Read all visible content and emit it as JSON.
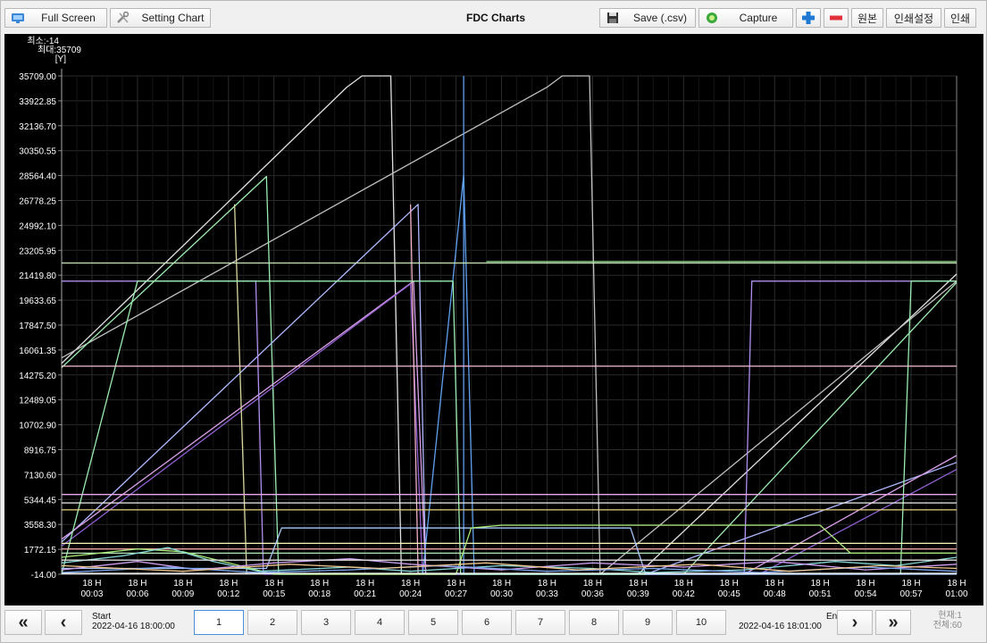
{
  "toolbar": {
    "full_screen": "Full Screen",
    "setting_chart": "Setting Chart",
    "title": "FDC Charts",
    "save": "Save (.csv)",
    "capture": "Capture",
    "original": "원본",
    "print_settings": "인쇄설정",
    "print": "인쇄",
    "icons": [
      "monitor-icon",
      "tools-icon",
      "floppy-disk-icon",
      "capture-icon",
      "zoom-in-icon",
      "zoom-out-icon"
    ]
  },
  "info": {
    "min_label": "최소:-14",
    "max_label": "최대:35709",
    "unit_label": "[Y]"
  },
  "nav": {
    "start_label": "Start",
    "start_value": "2022-04-16 18:00:00",
    "end_label": "End",
    "end_value": "2022-04-16 18:01:00",
    "pages": [
      "1",
      "2",
      "3",
      "4",
      "5",
      "6",
      "7",
      "8",
      "9",
      "10"
    ],
    "active_page": 0,
    "current_label": "현재:1",
    "total_label": "전체:60"
  },
  "chart_data": {
    "type": "line",
    "title": "",
    "xlabel": "",
    "ylabel": "[Y]",
    "ylim": [
      -14,
      35709
    ],
    "xlim": [
      1,
      60
    ],
    "grid": true,
    "y_ticks": [
      "35709.00",
      "33922.85",
      "32136.70",
      "30350.55",
      "28564.40",
      "26778.25",
      "24992.10",
      "23205.95",
      "21419.80",
      "19633.65",
      "17847.50",
      "16061.35",
      "14275.20",
      "12489.05",
      "10702.90",
      "8916.75",
      "7130.60",
      "5344.45",
      "3558.30",
      "1772.15",
      "-14.00"
    ],
    "x_ticks": [
      {
        "x": 3,
        "hour": "18 H",
        "time": "00:03"
      },
      {
        "x": 6,
        "hour": "18 H",
        "time": "00:06"
      },
      {
        "x": 9,
        "hour": "18 H",
        "time": "00:09"
      },
      {
        "x": 12,
        "hour": "18 H",
        "time": "00:12"
      },
      {
        "x": 15,
        "hour": "18 H",
        "time": "00:15"
      },
      {
        "x": 18,
        "hour": "18 H",
        "time": "00:18"
      },
      {
        "x": 21,
        "hour": "18 H",
        "time": "00:21"
      },
      {
        "x": 24,
        "hour": "18 H",
        "time": "00:24"
      },
      {
        "x": 27,
        "hour": "18 H",
        "time": "00:27"
      },
      {
        "x": 30,
        "hour": "18 H",
        "time": "00:30"
      },
      {
        "x": 33,
        "hour": "18 H",
        "time": "00:33"
      },
      {
        "x": 36,
        "hour": "18 H",
        "time": "00:36"
      },
      {
        "x": 39,
        "hour": "18 H",
        "time": "00:39"
      },
      {
        "x": 42,
        "hour": "18 H",
        "time": "00:42"
      },
      {
        "x": 45,
        "hour": "18 H",
        "time": "00:45"
      },
      {
        "x": 48,
        "hour": "18 H",
        "time": "00:48"
      },
      {
        "x": 51,
        "hour": "18 H",
        "time": "00:51"
      },
      {
        "x": 54,
        "hour": "18 H",
        "time": "00:54"
      },
      {
        "x": 57,
        "hour": "18 H",
        "time": "00:57"
      },
      {
        "x": 60,
        "hour": "18 H",
        "time": "01:00"
      }
    ],
    "series": [
      {
        "color": "#e0e0e0",
        "points": [
          [
            1,
            15100
          ],
          [
            19.8,
            34900
          ],
          [
            20.8,
            35709
          ],
          [
            22.7,
            35709
          ],
          [
            23.4,
            -14
          ],
          [
            39,
            -14
          ],
          [
            60,
            21500
          ]
        ]
      },
      {
        "color": "#c0c0c0",
        "points": [
          [
            1,
            15500
          ],
          [
            33,
            34900
          ],
          [
            34,
            35709
          ],
          [
            35.8,
            35709
          ],
          [
            36.5,
            -14
          ],
          [
            60,
            21000
          ]
        ]
      },
      {
        "color": "#9cecb0",
        "points": [
          [
            1,
            14800
          ],
          [
            14.5,
            28500
          ],
          [
            15.3,
            -14
          ],
          [
            42,
            -14
          ],
          [
            60,
            20900
          ]
        ]
      },
      {
        "color": "#b0b8ff",
        "points": [
          [
            1,
            2300
          ],
          [
            24.5,
            26500
          ],
          [
            25,
            -14
          ],
          [
            39.5,
            -14
          ],
          [
            60,
            8000
          ]
        ]
      },
      {
        "color": "#d9a0e8",
        "points": [
          [
            1,
            2500
          ],
          [
            24.2,
            21000
          ],
          [
            25,
            -14
          ],
          [
            46,
            -14
          ],
          [
            60,
            8500
          ]
        ]
      },
      {
        "color": "#9060d0",
        "points": [
          [
            1,
            2000
          ],
          [
            24,
            20800
          ],
          [
            24.8,
            -14
          ],
          [
            47,
            -14
          ],
          [
            60,
            7500
          ]
        ]
      },
      {
        "color": "#60a0f0",
        "points": [
          [
            24.8,
            -14
          ],
          [
            27.5,
            28600
          ],
          [
            28.2,
            -14
          ]
        ]
      },
      {
        "color": "#60a0f0",
        "points": [
          [
            27.5,
            -14
          ],
          [
            27.5,
            35709
          ]
        ]
      },
      {
        "color": "#f0b0c8",
        "points": [
          [
            24,
            26500
          ],
          [
            24.5,
            -14
          ]
        ]
      },
      {
        "color": "#d8d8a0",
        "points": [
          [
            12.4,
            26500
          ],
          [
            13.2,
            -14
          ]
        ]
      },
      {
        "color": "#b090f0",
        "points": [
          [
            1,
            21000
          ],
          [
            13.8,
            21000
          ],
          [
            14.3,
            -14
          ],
          [
            46,
            -14
          ],
          [
            46.5,
            21000
          ],
          [
            60,
            21000
          ]
        ]
      },
      {
        "color": "#9cecb0",
        "points": [
          [
            1,
            -14
          ],
          [
            6,
            21000
          ],
          [
            26.8,
            21000
          ],
          [
            27.3,
            -14
          ],
          [
            56.3,
            -14
          ],
          [
            57,
            21000
          ],
          [
            60,
            21000
          ]
        ]
      },
      {
        "color": "#c8e8b8",
        "points": [
          [
            1,
            22300
          ],
          [
            60,
            22300
          ]
        ]
      },
      {
        "color": "#90d890",
        "points": [
          [
            29,
            22400
          ],
          [
            60,
            22400
          ]
        ]
      },
      {
        "color": "#f8c0d8",
        "points": [
          [
            1,
            14900
          ],
          [
            60,
            14900
          ]
        ]
      },
      {
        "color": "#e8a8e8",
        "points": [
          [
            1,
            5700
          ],
          [
            60,
            5700
          ]
        ]
      },
      {
        "color": "#f0f0f0",
        "points": [
          [
            1,
            5100
          ],
          [
            60,
            5100
          ]
        ]
      },
      {
        "color": "#e8d080",
        "points": [
          [
            1,
            4600
          ],
          [
            60,
            4600
          ]
        ]
      },
      {
        "color": "#f8f8b8",
        "points": [
          [
            1,
            2200
          ],
          [
            60,
            2200
          ]
        ]
      },
      {
        "color": "#e8a0a0",
        "points": [
          [
            1,
            1800
          ],
          [
            60,
            1800
          ]
        ]
      },
      {
        "color": "#b8e8b8",
        "points": [
          [
            1,
            1500
          ],
          [
            60,
            1500
          ]
        ]
      },
      {
        "color": "#a8c8f8",
        "points": [
          [
            1,
            400
          ],
          [
            14.5,
            400
          ],
          [
            15.5,
            3300
          ],
          [
            38.5,
            3300
          ],
          [
            39.5,
            -14
          ],
          [
            60,
            -14
          ]
        ]
      },
      {
        "color": "#a8e878",
        "points": [
          [
            1,
            1200
          ],
          [
            6,
            1800
          ],
          [
            9,
            1600
          ],
          [
            12,
            800
          ],
          [
            15,
            -14
          ],
          [
            27,
            -14
          ],
          [
            28,
            3300
          ],
          [
            30,
            3500
          ],
          [
            51,
            3500
          ],
          [
            53,
            1500
          ],
          [
            60,
            1500
          ]
        ]
      },
      {
        "color": "#88d8d8",
        "points": [
          [
            1,
            800
          ],
          [
            5,
            1300
          ],
          [
            8,
            1900
          ],
          [
            11,
            900
          ],
          [
            14,
            200
          ],
          [
            20,
            500
          ],
          [
            24,
            200
          ],
          [
            30,
            600
          ],
          [
            36,
            400
          ],
          [
            40,
            100
          ],
          [
            46,
            300
          ],
          [
            52,
            900
          ],
          [
            56,
            600
          ],
          [
            60,
            1200
          ]
        ]
      },
      {
        "color": "#d0a0f0",
        "points": [
          [
            1,
            300
          ],
          [
            6,
            900
          ],
          [
            10,
            300
          ],
          [
            15,
            800
          ],
          [
            20,
            1100
          ],
          [
            24,
            700
          ],
          [
            30,
            300
          ],
          [
            36,
            800
          ],
          [
            42,
            500
          ],
          [
            48,
            900
          ],
          [
            54,
            300
          ],
          [
            60,
            700
          ]
        ]
      },
      {
        "color": "#80a8f0",
        "points": [
          [
            1,
            100
          ],
          [
            8,
            500
          ],
          [
            14,
            100
          ],
          [
            20,
            300
          ],
          [
            26,
            600
          ],
          [
            33,
            200
          ],
          [
            40,
            400
          ],
          [
            47,
            100
          ],
          [
            54,
            500
          ],
          [
            60,
            200
          ]
        ]
      },
      {
        "color": "#f0c890",
        "points": [
          [
            1,
            600
          ],
          [
            9,
            200
          ],
          [
            16,
            700
          ],
          [
            22,
            400
          ],
          [
            29,
            800
          ],
          [
            35,
            300
          ],
          [
            43,
            700
          ],
          [
            49,
            200
          ],
          [
            55,
            600
          ],
          [
            60,
            400
          ]
        ]
      },
      {
        "color": "#e0e0e0",
        "points": [
          [
            1,
            1000
          ],
          [
            60,
            1000
          ]
        ]
      },
      {
        "color": "#ffffff",
        "points": [
          [
            1,
            50
          ],
          [
            60,
            50
          ]
        ]
      }
    ]
  }
}
